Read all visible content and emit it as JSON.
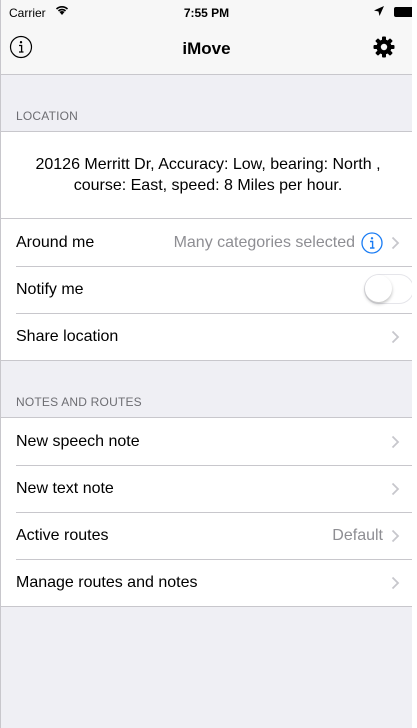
{
  "status_bar": {
    "carrier": "Carrier",
    "time": "7:55 PM"
  },
  "nav": {
    "title": "iMove",
    "left_icon": "info-icon",
    "right_icon": "gear-icon"
  },
  "location_section": {
    "header": "LOCATION",
    "address": "20126 Merritt Dr, Accuracy: Low, bearing: North , course: East, speed: 8 Miles per hour.",
    "rows": {
      "around_me": {
        "label": "Around me",
        "detail": "Many categories selected"
      },
      "notify_me": {
        "label": "Notify me",
        "toggle_on": false
      },
      "share_location": {
        "label": "Share location"
      }
    }
  },
  "notes_section": {
    "header": "NOTES AND ROUTES",
    "rows": {
      "new_speech_note": {
        "label": "New speech note"
      },
      "new_text_note": {
        "label": "New text note"
      },
      "active_routes": {
        "label": "Active routes",
        "detail": "Default"
      },
      "manage": {
        "label": "Manage routes and notes"
      }
    }
  },
  "colors": {
    "tint": "#1a7cf4",
    "background": "#efeff4",
    "separator": "#c8c7cc",
    "secondary_text": "#8e8e93",
    "chevron": "#c7c7cc"
  }
}
